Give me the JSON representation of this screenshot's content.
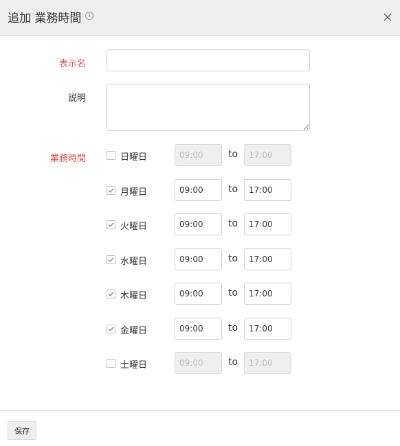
{
  "dialog": {
    "title": "追加 業務時間",
    "info_icon": "info-circle-icon",
    "close_icon": "close-icon"
  },
  "form": {
    "name_label": "表示名",
    "name_value": "",
    "description_label": "説明",
    "description_value": "",
    "hours_label": "業務時間",
    "to_label": "to",
    "days": [
      {
        "name": "日曜日",
        "checked": false,
        "start": "09:00",
        "end": "17:00"
      },
      {
        "name": "月曜日",
        "checked": true,
        "start": "09:00",
        "end": "17:00"
      },
      {
        "name": "火曜日",
        "checked": true,
        "start": "09:00",
        "end": "17:00"
      },
      {
        "name": "水曜日",
        "checked": true,
        "start": "09:00",
        "end": "17:00"
      },
      {
        "name": "木曜日",
        "checked": true,
        "start": "09:00",
        "end": "17:00"
      },
      {
        "name": "金曜日",
        "checked": true,
        "start": "09:00",
        "end": "17:00"
      },
      {
        "name": "土曜日",
        "checked": false,
        "start": "09:00",
        "end": "17:00"
      }
    ]
  },
  "footer": {
    "save_label": "保存"
  },
  "colors": {
    "required_label": "#d9534f",
    "header_bg": "#efefef",
    "disabled_bg": "#eeeeee"
  }
}
